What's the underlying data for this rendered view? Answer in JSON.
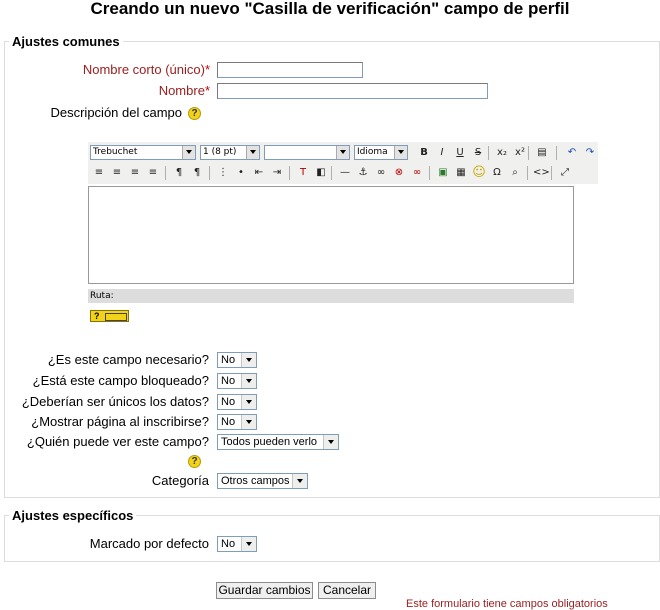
{
  "page": {
    "title": "Creando un nuevo \"Casilla de verificación\" campo de perfil"
  },
  "common": {
    "legend": "Ajustes comunes",
    "shortname_label": "Nombre corto (único)",
    "name_label": "Nombre",
    "required_mark": "*",
    "description_label": "Descripción del campo",
    "help_glyph": "?"
  },
  "editor": {
    "font_family": "Trebuchet",
    "font_size": "1 (8 pt)",
    "format": "",
    "language": "Idioma",
    "path_label": "Ruta:",
    "buttons_row1": [
      {
        "name": "bold-icon",
        "glyph": "B"
      },
      {
        "name": "italic-icon",
        "glyph": "I"
      },
      {
        "name": "underline-icon",
        "glyph": "U"
      },
      {
        "name": "strikethrough-icon",
        "glyph": "S"
      },
      {
        "name": "subscript-icon",
        "glyph": "x₂"
      },
      {
        "name": "superscript-icon",
        "glyph": "x²"
      },
      {
        "name": "clean-word-icon",
        "glyph": "▤"
      },
      {
        "name": "undo-icon",
        "glyph": "↶"
      },
      {
        "name": "redo-icon",
        "glyph": "↷"
      }
    ],
    "buttons_row2": [
      {
        "name": "align-left-icon",
        "glyph": "≡"
      },
      {
        "name": "align-center-icon",
        "glyph": "≡"
      },
      {
        "name": "align-right-icon",
        "glyph": "≡"
      },
      {
        "name": "justify-icon",
        "glyph": "≡"
      },
      {
        "name": "ltr-icon",
        "glyph": "¶"
      },
      {
        "name": "rtl-icon",
        "glyph": "¶"
      },
      {
        "name": "ordered-list-icon",
        "glyph": "⋮"
      },
      {
        "name": "unordered-list-icon",
        "glyph": "•"
      },
      {
        "name": "outdent-icon",
        "glyph": "⇤"
      },
      {
        "name": "indent-icon",
        "glyph": "⇥"
      },
      {
        "name": "text-color-icon",
        "glyph": "T"
      },
      {
        "name": "background-color-icon",
        "glyph": "◧"
      },
      {
        "name": "horizontal-rule-icon",
        "glyph": "—"
      },
      {
        "name": "anchor-icon",
        "glyph": "⚓"
      },
      {
        "name": "link-icon",
        "glyph": "∞"
      },
      {
        "name": "unlink-icon",
        "glyph": "⊗"
      },
      {
        "name": "nolink-icon",
        "glyph": "∞"
      },
      {
        "name": "image-icon",
        "glyph": "▣"
      },
      {
        "name": "table-icon",
        "glyph": "▦"
      },
      {
        "name": "smiley-icon",
        "glyph": "☺"
      },
      {
        "name": "special-char-icon",
        "glyph": "Ω"
      },
      {
        "name": "search-replace-icon",
        "glyph": "⌕"
      },
      {
        "name": "html-source-icon",
        "glyph": "<>"
      },
      {
        "name": "fullscreen-icon",
        "glyph": "⤢"
      }
    ]
  },
  "fields": {
    "required_label": "¿Es este campo necesario?",
    "required_value": "No",
    "locked_label": "¿Está este campo bloqueado?",
    "locked_value": "No",
    "unique_label": "¿Deberían ser únicos los datos?",
    "unique_value": "No",
    "signup_label": "¿Mostrar página al inscribirse?",
    "signup_value": "No",
    "visible_label": "¿Quién puede ver este campo?",
    "visible_value": "Todos pueden verlo",
    "category_label": "Categoría",
    "category_value": "Otros campos"
  },
  "specific": {
    "legend": "Ajustes específicos",
    "default_label": "Marcado por defecto",
    "default_value": "No"
  },
  "actions": {
    "save_label": "Guardar cambios",
    "cancel_label": "Cancelar",
    "footer_note": "Este formulario tiene campos obligatorios"
  }
}
